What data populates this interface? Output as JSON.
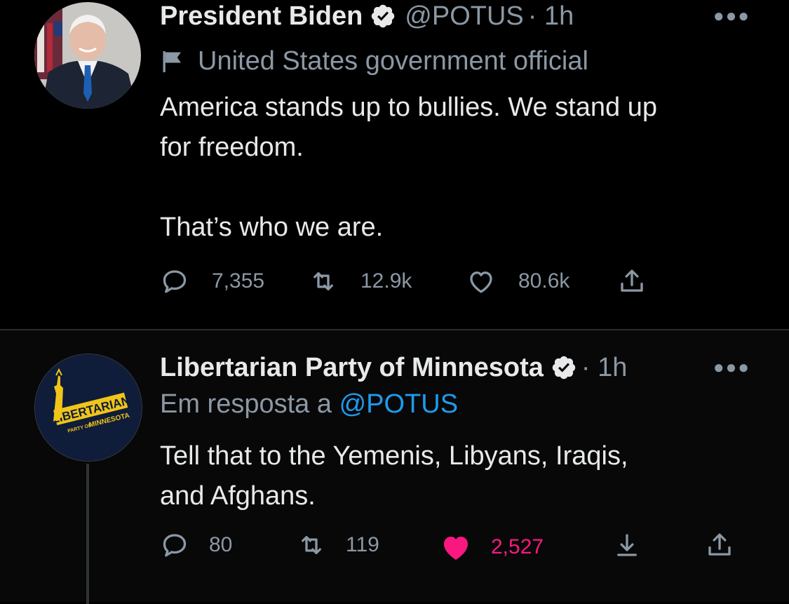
{
  "tweets": [
    {
      "author": "President Biden",
      "handle": "@POTUS",
      "time": "· 1h",
      "more_icon": "more-dots-icon",
      "label": "United States government official",
      "text": "America stands up to bullies. We stand up\nfor freedom.\n\nThat’s who we are.",
      "replies": "7,355",
      "retweets": "12.9k",
      "likes": "80.6k"
    },
    {
      "author": "Libertarian Party of Minnesota",
      "time": "· 1h",
      "reply_prefix": "Em resposta a ",
      "reply_mention": "@POTUS",
      "text": "Tell that to the Yemenis, Libyans, Iraqis,\nand Afghans.",
      "replies": "80",
      "retweets": "119",
      "likes": "2,527",
      "liked": true,
      "avatar_text": {
        "line1": "LIBERTARIAN",
        "line2": "PARTY OF",
        "line3": "MINNESOTA"
      }
    }
  ],
  "colors": {
    "background": "#000000",
    "text": "#e7e9ea",
    "muted": "#8b98a5",
    "link": "#1d9bf0",
    "like": "#f91880"
  }
}
